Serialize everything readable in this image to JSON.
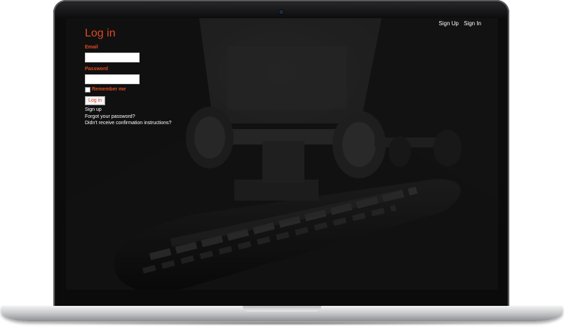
{
  "nav": {
    "sign_up": "Sign Up",
    "sign_in": "Sign In"
  },
  "login": {
    "title": "Log in",
    "email_label": "Email",
    "email_value": "",
    "password_label": "Password",
    "password_value": "",
    "remember_label": "Remember me",
    "remember_checked": false,
    "submit_label": "Log in"
  },
  "links": {
    "sign_up": "Sign up",
    "forgot_password": "Forgot your password?",
    "confirmation": "Didn't receive confirmation instructions?"
  },
  "colors": {
    "accent": "#e04a24",
    "screen_bg": "#141414"
  },
  "icons": {
    "camera": "webcam-icon"
  }
}
